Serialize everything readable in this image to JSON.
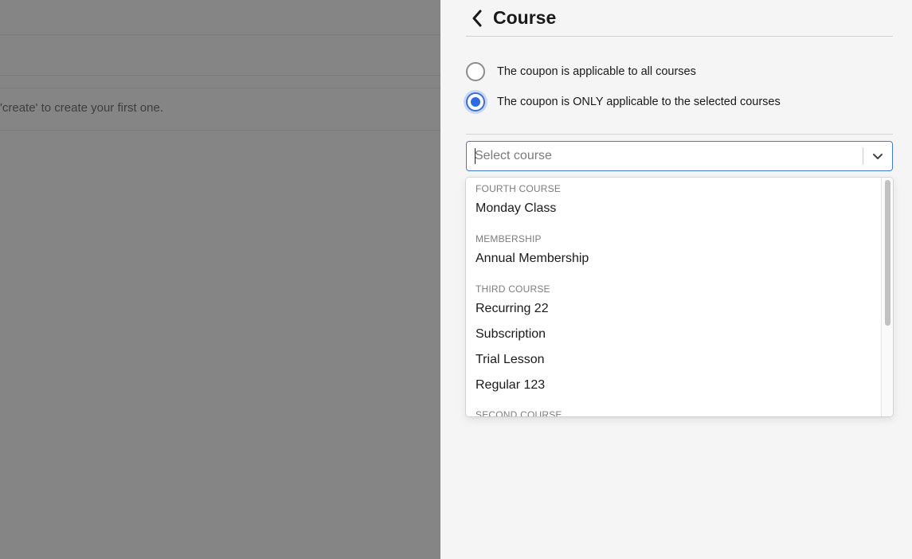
{
  "background": {
    "hint_text": "'create' to create your first one."
  },
  "panel": {
    "title": "Course",
    "back_icon": "chevron-left-icon"
  },
  "scope": {
    "options": [
      {
        "label": "The coupon is applicable to all courses",
        "checked": false
      },
      {
        "label": "The coupon is ONLY applicable to the selected courses",
        "checked": true
      }
    ]
  },
  "course_select": {
    "placeholder": "Select course",
    "value": "",
    "dropdown_icon": "chevron-down-icon"
  },
  "menu": {
    "groups": [
      {
        "name": "FOURTH COURSE",
        "options": [
          "Monday Class"
        ]
      },
      {
        "name": "MEMBERSHIP",
        "options": [
          "Annual Membership"
        ]
      },
      {
        "name": "THIRD COURSE",
        "options": [
          "Recurring 22",
          "Subscription",
          "Trial Lesson",
          "Regular 123"
        ]
      },
      {
        "name": "SECOND COURSE",
        "options": []
      }
    ]
  },
  "colors": {
    "accent": "#2f6be0",
    "backdrop": "#858585"
  }
}
